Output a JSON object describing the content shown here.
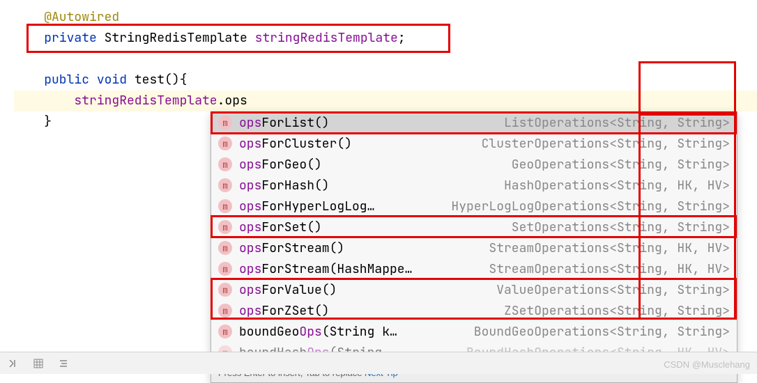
{
  "code": {
    "line1_annotation": "@Autowired",
    "line2_private": "private",
    "line2_type": "StringRedisTemplate",
    "line2_field": "stringRedisTemplate",
    "line2_semi": ";",
    "line4_public": "public",
    "line4_void": "void",
    "line4_method": "test",
    "line4_parens": "(){",
    "line5_field": "stringRedisTemplate",
    "line5_dot": ".",
    "line5_typed": "ops",
    "line6_brace": "}"
  },
  "autocomplete": {
    "icon_letter": "m",
    "items": [
      {
        "match": "ops",
        "rest": "ForList()",
        "return": "ListOperations<String, String>",
        "selected": true
      },
      {
        "match": "ops",
        "rest": "ForCluster()",
        "return": "ClusterOperations<String, String>",
        "selected": false
      },
      {
        "match": "ops",
        "rest": "ForGeo()",
        "return": "GeoOperations<String, String>",
        "selected": false
      },
      {
        "match": "ops",
        "rest": "ForHash()",
        "return": "HashOperations<String, HK, HV>",
        "selected": false
      },
      {
        "match": "ops",
        "rest": "ForHyperLogLog…",
        "return": "HyperLogLogOperations<String, String>",
        "selected": false
      },
      {
        "match": "ops",
        "rest": "ForSet()",
        "return": "SetOperations<String, String>",
        "selected": false
      },
      {
        "match": "ops",
        "rest": "ForStream()",
        "return": "StreamOperations<String, HK, HV>",
        "selected": false
      },
      {
        "match": "ops",
        "rest": "ForStream(HashMappe…",
        "return": "StreamOperations<String, HK, HV>",
        "selected": false
      },
      {
        "match": "ops",
        "rest": "ForValue()",
        "return": "ValueOperations<String, String>",
        "selected": false
      },
      {
        "match": "ops",
        "rest": "ForZSet()",
        "return": "ZSetOperations<String, String>",
        "selected": false
      },
      {
        "match": "",
        "rest": "boundGeo",
        "match2": "Ops",
        "rest2": "(String k…",
        "return": "BoundGeoOperations<String, String>",
        "selected": false
      },
      {
        "match": "",
        "rest": "boundHash",
        "match2": "Ops",
        "rest2": "(String …",
        "return": "BoundHashOperations<String, HK, HV>",
        "selected": false,
        "faded": true
      }
    ],
    "footer_text": "Press Enter to insert, Tab to replace",
    "footer_link": "Next Tip"
  },
  "watermark": "CSDN @Musclehang"
}
